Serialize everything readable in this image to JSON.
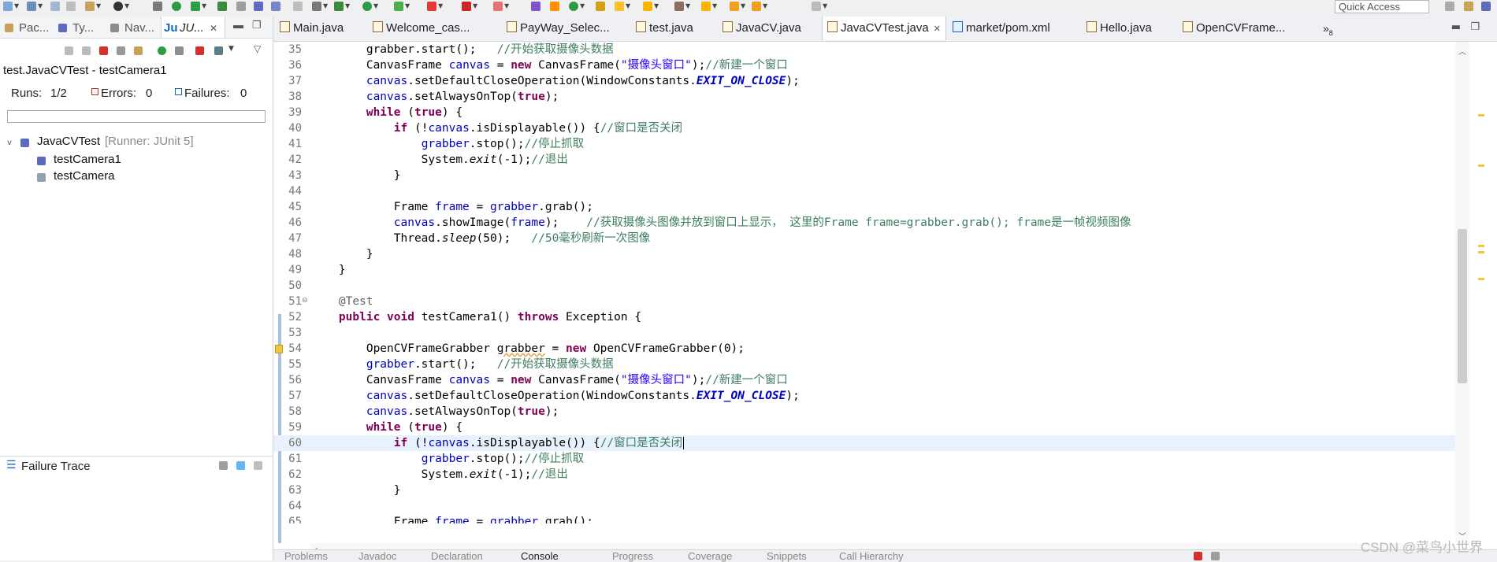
{
  "toolbar": {
    "quick_access": "Quick Access",
    "accent": "#1565c0"
  },
  "left_panel": {
    "tabs": [
      {
        "label": "Pac...",
        "icon": "package-explorer-icon"
      },
      {
        "label": "Ty...",
        "icon": "type-hierarchy-icon"
      },
      {
        "label": "Nav...",
        "icon": "navigator-icon"
      },
      {
        "label": "JU...",
        "icon": "junit-icon",
        "active": true
      }
    ],
    "junit": {
      "title": "test.JavaCVTest - testCamera1",
      "runs_label": "Runs:",
      "runs_value": "1/2",
      "errors_label": "Errors:",
      "errors_value": "0",
      "failures_label": "Failures:",
      "failures_value": "0",
      "progress": 0.0,
      "tree": {
        "root_label": "JavaCVTest",
        "root_runner": "[Runner: JUnit 5]",
        "children": [
          "testCamera1",
          "testCamera"
        ]
      }
    },
    "failure_trace": {
      "label": "Failure Trace"
    }
  },
  "editor": {
    "tabs": [
      {
        "label": "Main.java"
      },
      {
        "label": "Welcome_cas..."
      },
      {
        "label": "PayWay_Selec..."
      },
      {
        "label": "test.java"
      },
      {
        "label": "JavaCV.java"
      },
      {
        "label": "JavaCVTest.java",
        "active": true
      },
      {
        "label": "market/pom.xml"
      },
      {
        "label": "Hello.java"
      },
      {
        "label": "OpenCVFrame..."
      }
    ],
    "overflow_label": "»",
    "overflow_count": "8",
    "lines": [
      {
        "n": "35",
        "text": "        grabber.start();   //开始获取摄像头数据"
      },
      {
        "n": "36",
        "text": "        CanvasFrame canvas = new CanvasFrame(\"摄像头窗口\");//新建一个窗口"
      },
      {
        "n": "37",
        "text": "        canvas.setDefaultCloseOperation(WindowConstants.EXIT_ON_CLOSE);"
      },
      {
        "n": "38",
        "text": "        canvas.setAlwaysOnTop(true);"
      },
      {
        "n": "39",
        "text": "        while (true) {"
      },
      {
        "n": "40",
        "text": "            if (!canvas.isDisplayable()) {//窗口是否关闭"
      },
      {
        "n": "41",
        "text": "                grabber.stop();//停止抓取"
      },
      {
        "n": "42",
        "text": "                System.exit(-1);//退出"
      },
      {
        "n": "43",
        "text": "            }"
      },
      {
        "n": "44",
        "text": ""
      },
      {
        "n": "45",
        "text": "            Frame frame = grabber.grab();"
      },
      {
        "n": "46",
        "text": "            canvas.showImage(frame);    //获取摄像头图像并放到窗口上显示， 这里的Frame frame=grabber.grab(); frame是一帧视频图像"
      },
      {
        "n": "47",
        "text": "            Thread.sleep(50);   //50毫秒刷新一次图像"
      },
      {
        "n": "48",
        "text": "        }"
      },
      {
        "n": "49",
        "text": "    }"
      },
      {
        "n": "50",
        "text": ""
      },
      {
        "n": "51",
        "text": "    @Test"
      },
      {
        "n": "52",
        "text": "    public void testCamera1() throws Exception {"
      },
      {
        "n": "53",
        "text": ""
      },
      {
        "n": "54",
        "text": "        OpenCVFrameGrabber grabber = new OpenCVFrameGrabber(0);"
      },
      {
        "n": "55",
        "text": "        grabber.start();   //开始获取摄像头数据"
      },
      {
        "n": "56",
        "text": "        CanvasFrame canvas = new CanvasFrame(\"摄像头窗口\");//新建一个窗口"
      },
      {
        "n": "57",
        "text": "        canvas.setDefaultCloseOperation(WindowConstants.EXIT_ON_CLOSE);"
      },
      {
        "n": "58",
        "text": "        canvas.setAlwaysOnTop(true);"
      },
      {
        "n": "59",
        "text": "        while (true) {"
      },
      {
        "n": "60",
        "text": "            if (!canvas.isDisplayable()) {//窗口是否关闭"
      },
      {
        "n": "61",
        "text": "                grabber.stop();//停止抓取"
      },
      {
        "n": "62",
        "text": "                System.exit(-1);//退出"
      },
      {
        "n": "63",
        "text": "            }"
      },
      {
        "n": "64",
        "text": ""
      },
      {
        "n": "65",
        "text": "            Frame frame = grabber.grab();"
      }
    ],
    "current_line": "60"
  },
  "bottom_tabs": [
    "Problems",
    "Javadoc",
    "Declaration",
    "Console",
    "Progress",
    "Coverage",
    "Snippets",
    "Call Hierarchy"
  ],
  "bottom_active_tab": "Console",
  "watermark": "CSDN @菜鸟小世界",
  "colors": {
    "keyword": "#7f0055",
    "string": "#2a00ff",
    "comment": "#3f7f5f",
    "field": "#0000c0",
    "current_line_bg": "#e8f2fe",
    "runs_red": "#c62828",
    "runs_blue": "#1565c0"
  }
}
